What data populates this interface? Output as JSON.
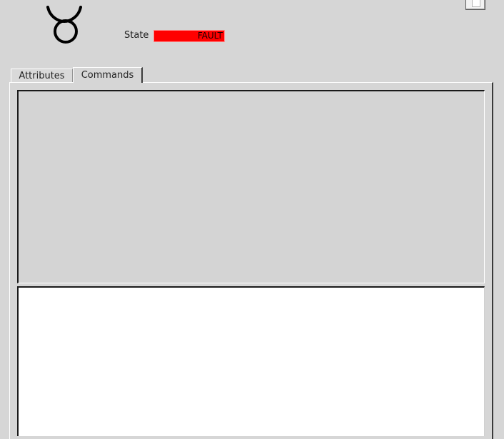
{
  "header": {
    "icon": "taurus-icon",
    "state_label": "State",
    "state_value": "FAULT",
    "state_color": "#ff0000"
  },
  "tabs": [
    {
      "label": "Attributes",
      "active": false
    },
    {
      "label": "Commands",
      "active": true
    }
  ],
  "colors": {
    "background": "#d6d6d6",
    "output_background": "#ffffff"
  }
}
